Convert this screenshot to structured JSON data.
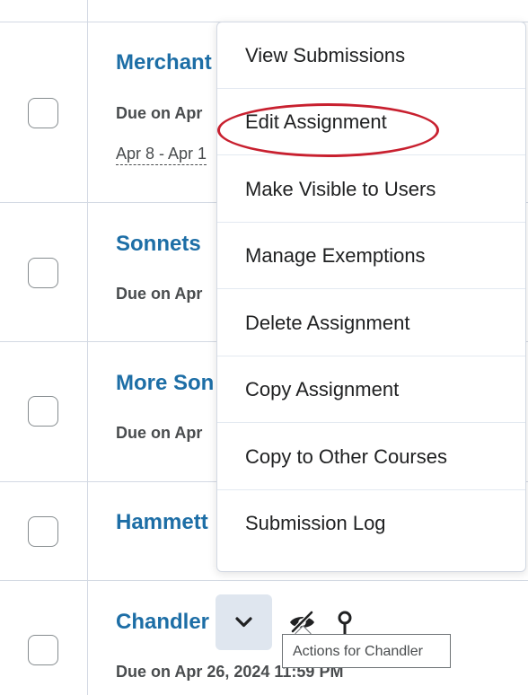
{
  "rows": [
    {
      "title": "Merchant",
      "due": "Due on Apr",
      "range": "Apr 8 - Apr 1"
    },
    {
      "title": "Sonnets",
      "due": "Due on Apr"
    },
    {
      "title": "More Son",
      "due": "Due on Apr"
    },
    {
      "title": "Hammett"
    },
    {
      "title": "Chandler",
      "due": "Due on Apr 26, 2024 11:59 PM"
    }
  ],
  "menu": {
    "items": [
      "View Submissions",
      "Edit Assignment",
      "Make Visible to Users",
      "Manage Exemptions",
      "Delete Assignment",
      "Copy Assignment",
      "Copy to Other Courses",
      "Submission Log"
    ],
    "highlighted_item": "Edit Assignment",
    "highlight_color": "#c8202f"
  },
  "actions": {
    "icons": [
      "chevron-down-icon",
      "eye-hidden-icon",
      "pin-icon"
    ],
    "tooltip": "Actions for Chandler"
  },
  "colors": {
    "link": "#1d6ea6",
    "text": "#494c4e",
    "button_bg": "#dfe6ef"
  }
}
